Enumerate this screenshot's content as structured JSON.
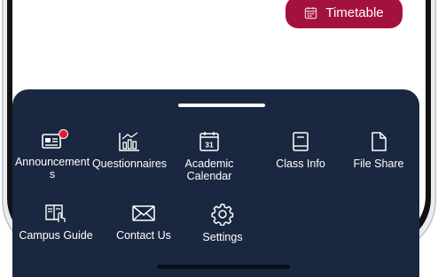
{
  "top_button": {
    "label": "Timetable",
    "icon": "calendar-icon"
  },
  "menu": {
    "row1": [
      {
        "label": "Announcement\ns",
        "icon": "announcement-icon",
        "notification": true,
        "badge_color": "#e0202e"
      },
      {
        "label": "Questionnaires",
        "icon": "bar-chart-icon"
      },
      {
        "label": "Academic\nCalendar",
        "icon": "calendar-31-icon",
        "icon_text": "31"
      },
      {
        "label": "Class Info",
        "icon": "book-icon"
      },
      {
        "label": "File Share",
        "icon": "file-icon"
      }
    ],
    "row2": [
      {
        "label": "Campus Guide",
        "icon": "guide-icon"
      },
      {
        "label": "Contact Us",
        "icon": "envelope-icon"
      },
      {
        "label": "Settings",
        "icon": "gear-icon"
      }
    ]
  },
  "colors": {
    "sheet": "#1a2740",
    "accent": "#a3123f",
    "text": "#ffffff"
  }
}
